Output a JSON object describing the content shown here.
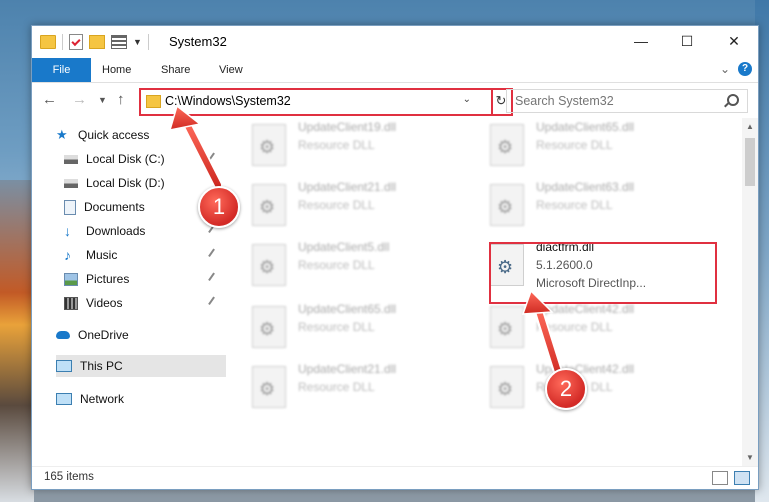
{
  "window": {
    "title": "System32",
    "minimize": "—",
    "maximize": "☐",
    "close": "✕"
  },
  "ribbon": {
    "tabs": [
      "File",
      "Home",
      "Share",
      "View"
    ],
    "expand": "⌄",
    "help": "?"
  },
  "address": {
    "path": "C:\\Windows\\System32",
    "search_placeholder": "Search System32"
  },
  "nav": {
    "quick_access": "Quick access",
    "items": [
      {
        "label": "Local Disk (C:)",
        "icon": "drive-icon"
      },
      {
        "label": "Local Disk (D:)",
        "icon": "drive-icon"
      },
      {
        "label": "Documents",
        "icon": "document-icon"
      },
      {
        "label": "Downloads",
        "icon": "download-icon"
      },
      {
        "label": "Music",
        "icon": "music-icon"
      },
      {
        "label": "Pictures",
        "icon": "picture-icon"
      },
      {
        "label": "Videos",
        "icon": "video-icon"
      }
    ],
    "onedrive": "OneDrive",
    "this_pc": "This PC",
    "network": "Network"
  },
  "files": [
    {
      "name": "UpdateClient19.dll",
      "type": "Resource DLL"
    },
    {
      "name": "UpdateClient65.dll",
      "type": "Resource DLL"
    },
    {
      "name": "UpdateClient21.dll",
      "type": "Resource DLL"
    },
    {
      "name": "UpdateClient63.dll",
      "type": "Resource DLL"
    },
    {
      "name": "UpdateClient5.dll",
      "type": "Resource DLL"
    },
    {
      "name": "UpdateClient65.dll",
      "type": "Resource DLL"
    },
    {
      "name": "UpdateClient42.dll",
      "type": "Resource DLL"
    },
    {
      "name": "UpdateClient21.dll",
      "type": "Resource DLL"
    },
    {
      "name": "UpdateClient42.dll",
      "type": "Resource DLL"
    }
  ],
  "highlight_file": {
    "name": "diactfrm.dll",
    "version": "5.1.2600.0",
    "description": "Microsoft DirectInp..."
  },
  "status": {
    "count": "165 items"
  },
  "callouts": {
    "one": "1",
    "two": "2"
  },
  "colors": {
    "accent": "#1979ca",
    "highlight": "#e03040"
  }
}
